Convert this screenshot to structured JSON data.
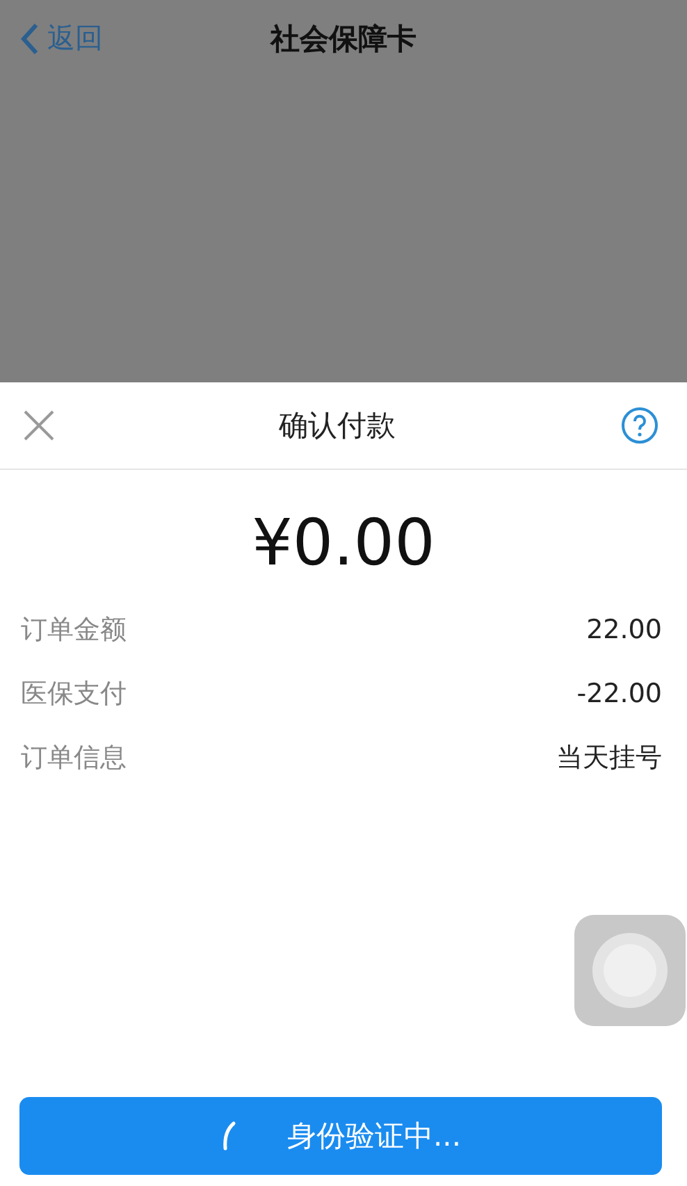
{
  "nav_bar": {
    "back_label": "返回",
    "title": "社会保障卡"
  },
  "payment_sheet": {
    "title": "确认付款",
    "amount": "¥0.00",
    "rows": [
      {
        "label": "订单金额",
        "value": "22.00"
      },
      {
        "label": "医保支付",
        "value": "-22.00"
      },
      {
        "label": "订单信息",
        "value": "当天挂号"
      }
    ],
    "button": {
      "label": "身份验证中...",
      "loading": true
    }
  }
}
